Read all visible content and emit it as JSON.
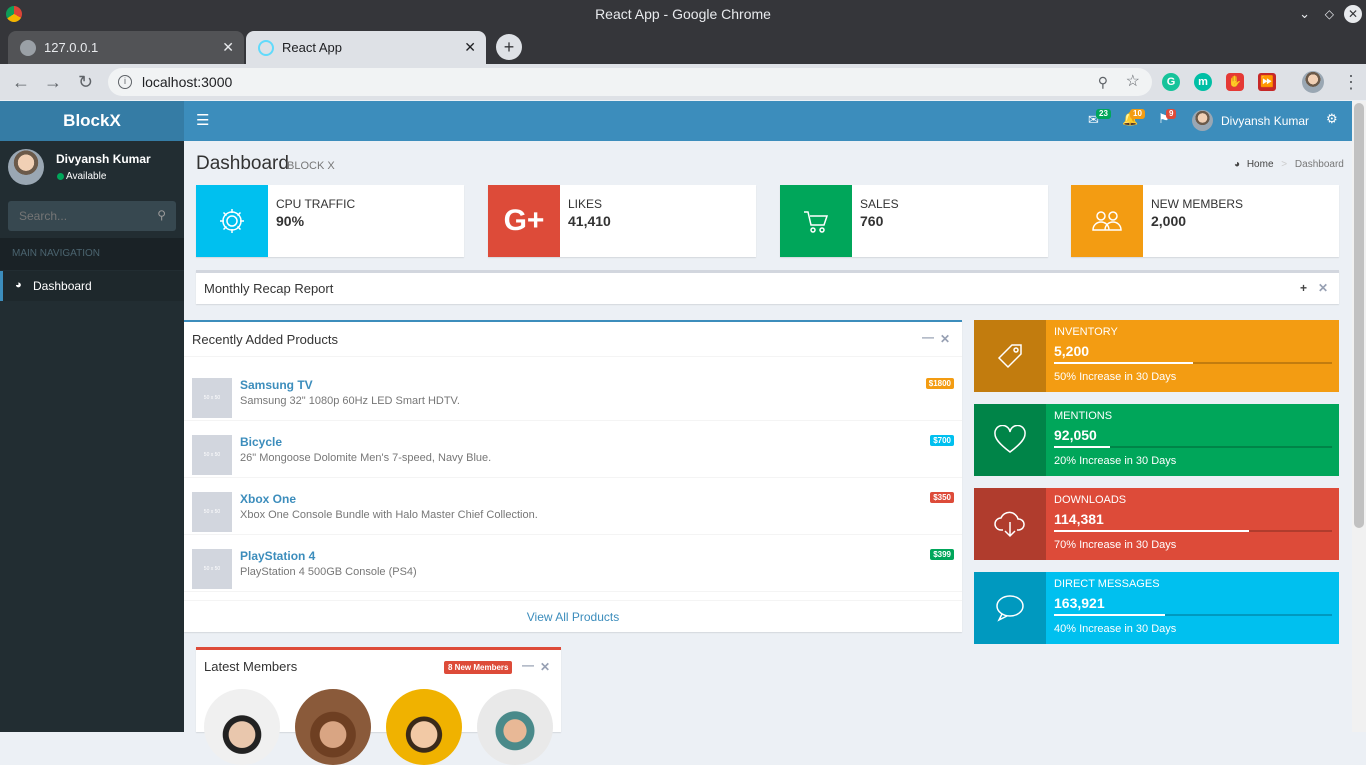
{
  "browser": {
    "window_title": "React App - Google Chrome",
    "url": "localhost:3000",
    "tabs": [
      {
        "label": "127.0.0.1"
      },
      {
        "label": "React App"
      }
    ]
  },
  "app": {
    "brand": "BlockX"
  },
  "user": {
    "name": "Divyansh Kumar",
    "status": "Available"
  },
  "search": {
    "placeholder": "Search..."
  },
  "sidebar": {
    "section": "MAIN NAVIGATION",
    "items": [
      {
        "label": "Dashboard"
      }
    ]
  },
  "notifications": {
    "messages": "23",
    "alerts": "10",
    "tasks": "9"
  },
  "page": {
    "title": "Dashboard",
    "subtitle": "BLOCK X",
    "breadcrumb": [
      "Home",
      "Dashboard"
    ]
  },
  "info_boxes": [
    {
      "label": "CPU TRAFFIC",
      "value": "90%",
      "color": "#00c0ef",
      "icon": "gear-icon"
    },
    {
      "label": "LIKES",
      "value": "41,410",
      "color": "#dd4b39",
      "icon": "google-plus-icon"
    },
    {
      "label": "SALES",
      "value": "760",
      "color": "#00a65a",
      "icon": "cart-icon"
    },
    {
      "label": "NEW MEMBERS",
      "value": "2,000",
      "color": "#f39c12",
      "icon": "users-icon"
    }
  ],
  "monthly_report": {
    "title": "Monthly Recap Report"
  },
  "products": {
    "title": "Recently Added Products",
    "footer": "View All Products",
    "thumb_text": "50 x 50",
    "items": [
      {
        "name": "Samsung TV",
        "desc": "Samsung 32\" 1080p 60Hz LED Smart HDTV.",
        "price": "$1800",
        "color": "#f39c12"
      },
      {
        "name": "Bicycle",
        "desc": "26\" Mongoose Dolomite Men's 7-speed, Navy Blue.",
        "price": "$700",
        "color": "#00c0ef"
      },
      {
        "name": "Xbox One",
        "desc": "Xbox One Console Bundle with Halo Master Chief Collection.",
        "price": "$350",
        "color": "#dd4b39"
      },
      {
        "name": "PlayStation 4",
        "desc": "PlayStation 4 500GB Console (PS4)",
        "price": "$399",
        "color": "#00a65a"
      }
    ]
  },
  "stats": [
    {
      "label": "INVENTORY",
      "value": "5,200",
      "progress": 0.5,
      "desc": "50% Increase in 30 Days",
      "color": "#f39c12",
      "icon": "tag-icon"
    },
    {
      "label": "MENTIONS",
      "value": "92,050",
      "progress": 0.2,
      "desc": "20% Increase in 30 Days",
      "color": "#00a65a",
      "icon": "heart-icon"
    },
    {
      "label": "DOWNLOADS",
      "value": "114,381",
      "progress": 0.7,
      "desc": "70% Increase in 30 Days",
      "color": "#dd4b39",
      "icon": "cloud-download-icon"
    },
    {
      "label": "DIRECT MESSAGES",
      "value": "163,921",
      "progress": 0.4,
      "desc": "40% Increase in 30 Days",
      "color": "#00c0ef",
      "icon": "chat-icon"
    }
  ],
  "members": {
    "title": "Latest Members",
    "badge": "8 New Members"
  }
}
